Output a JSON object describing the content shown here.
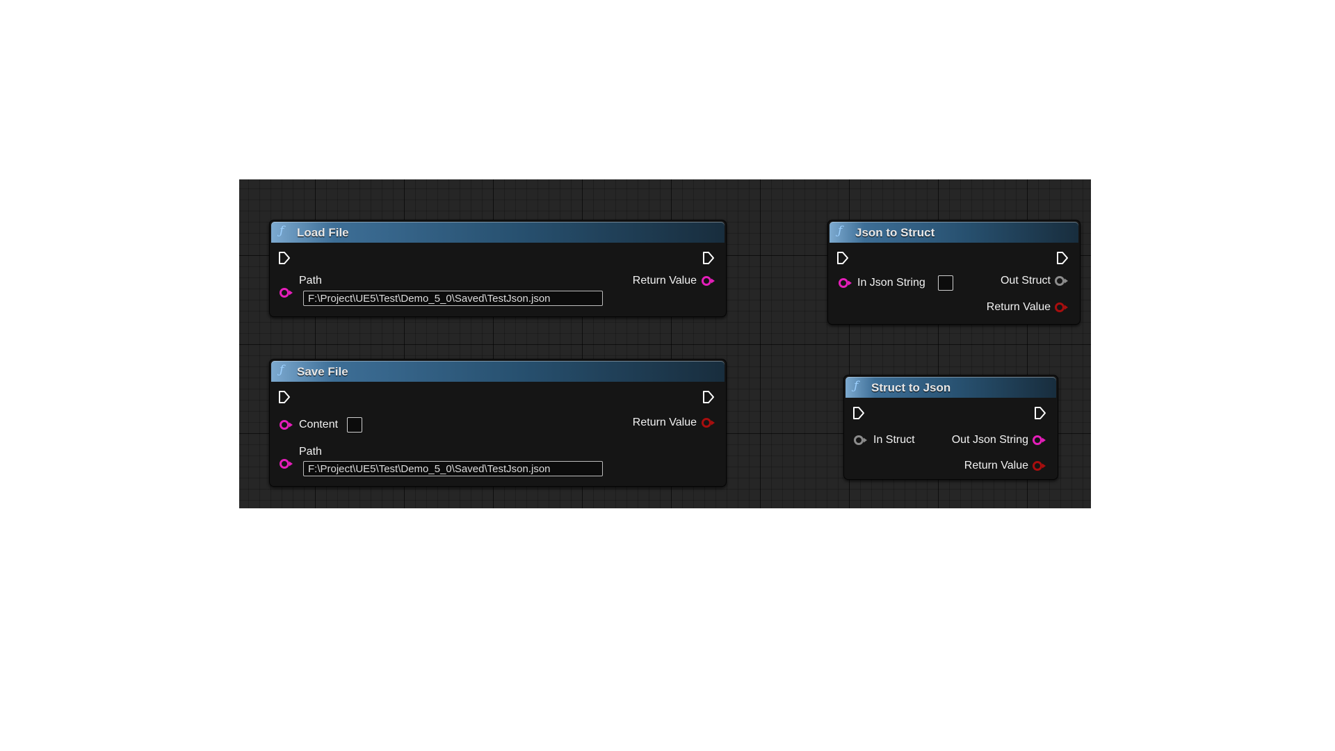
{
  "nodes": {
    "load_file": {
      "title": "Load File",
      "path_label": "Path",
      "path_value": "F:\\Project\\UE5\\Test\\Demo_5_0\\Saved\\TestJson.json",
      "return_label": "Return Value"
    },
    "save_file": {
      "title": "Save File",
      "content_label": "Content",
      "path_label": "Path",
      "path_value": "F:\\Project\\UE5\\Test\\Demo_5_0\\Saved\\TestJson.json",
      "return_label": "Return Value"
    },
    "json_to_struct": {
      "title": "Json to Struct",
      "in_label": "In Json String",
      "out_label": "Out Struct",
      "return_label": "Return Value"
    },
    "struct_to_json": {
      "title": "Struct to Json",
      "in_label": "In Struct",
      "out_label": "Out Json String",
      "return_label": "Return Value"
    }
  },
  "icons": {
    "function": "function-icon",
    "exec_in": "exec-in-pin-icon",
    "exec_out": "exec-out-pin-icon",
    "string_pin": "string-pin-icon",
    "struct_pin": "struct-pin-icon",
    "bool_pin": "bool-pin-icon"
  },
  "colors": {
    "graph_bg": "#262626",
    "node_body": "#151515",
    "header_accent": "#3d6e96",
    "string_pin": "#e51eba",
    "bool_pin": "#a80e0e",
    "struct_pin": "#8c8c8c",
    "exec_pin": "#ffffff"
  }
}
